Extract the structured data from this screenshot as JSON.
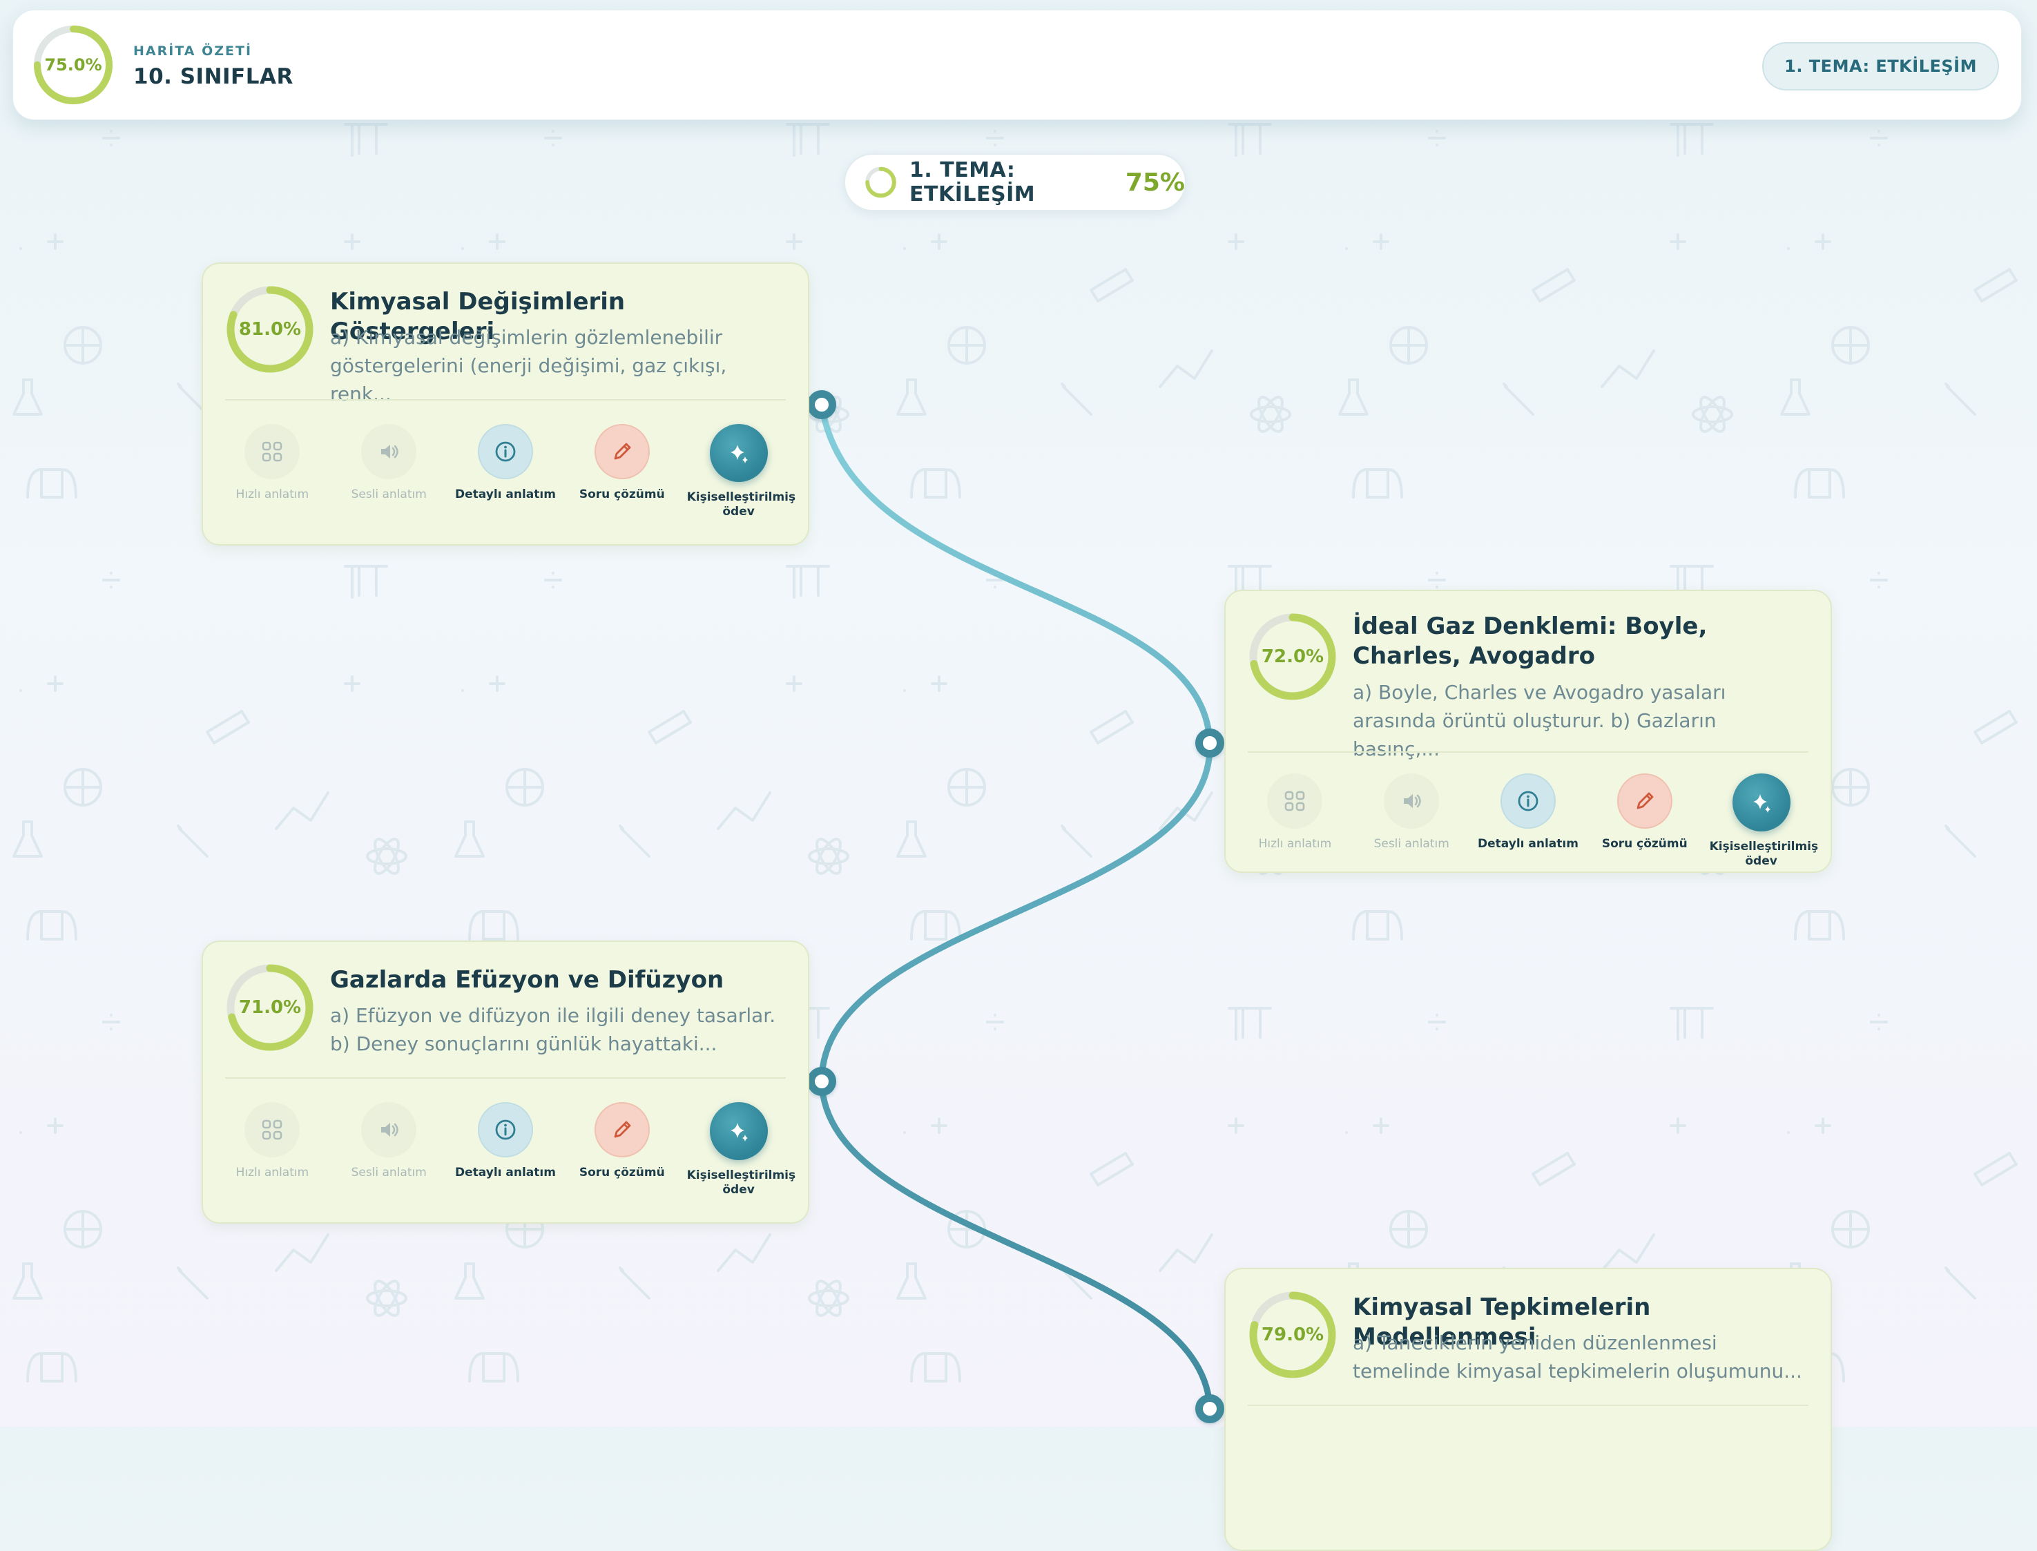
{
  "header": {
    "progress_percent": 75.0,
    "progress_label": "75.0%",
    "eyebrow": "HARİTA ÖZETİ",
    "title": "10. SINIFLAR",
    "theme_button": "1. TEMA: ETKİLEŞİM"
  },
  "theme": {
    "title": "1. TEMA: ETKİLEŞİM",
    "percent_label": "75%",
    "progress_percent": 75
  },
  "colors": {
    "accent_green": "#7ea72e",
    "ring_green": "#b8d45e",
    "teal": "#3f8a9d",
    "card_bg": "#f2f7e1"
  },
  "action_labels": [
    "Hızlı anlatım",
    "Sesli anlatım",
    "Detaylı anlatım",
    "Soru çözümü",
    "Kişiselleştirilmiş ödev"
  ],
  "action_icons": [
    "grid-icon",
    "speaker-icon",
    "info-icon",
    "pencil-icon",
    "sparkle-icon"
  ],
  "lessons": [
    {
      "title": "Kimyasal Değişimlerin Göstergeleri",
      "progress_percent": 81.0,
      "progress_label": "81.0%",
      "desc1": "a) Kimyasal değişimlerin gözlemlenebilir",
      "desc2": "göstergelerini (enerji değişimi, gaz çıkışı, renk..."
    },
    {
      "title": "İdeal Gaz Denklemi: Boyle, Charles, Avogadro",
      "progress_percent": 72.0,
      "progress_label": "72.0%",
      "desc1": "a) Boyle, Charles ve Avogadro yasaları",
      "desc2": "arasında örüntü oluşturur. b) Gazların basınç,..."
    },
    {
      "title": "Gazlarda Efüzyon ve Difüzyon",
      "progress_percent": 71.0,
      "progress_label": "71.0%",
      "desc1": "a) Efüzyon ve difüzyon ile ilgili deney tasarlar.",
      "desc2": "b) Deney sonuçlarını günlük hayattaki..."
    },
    {
      "title": "Kimyasal Tepkimelerin Modellenmesi",
      "progress_percent": 79.0,
      "progress_label": "79.0%",
      "desc1": "a) Taneciklerin yeniden düzenlenmesi",
      "desc2": "temelinde kimyasal tepkimelerin oluşumunu..."
    }
  ]
}
